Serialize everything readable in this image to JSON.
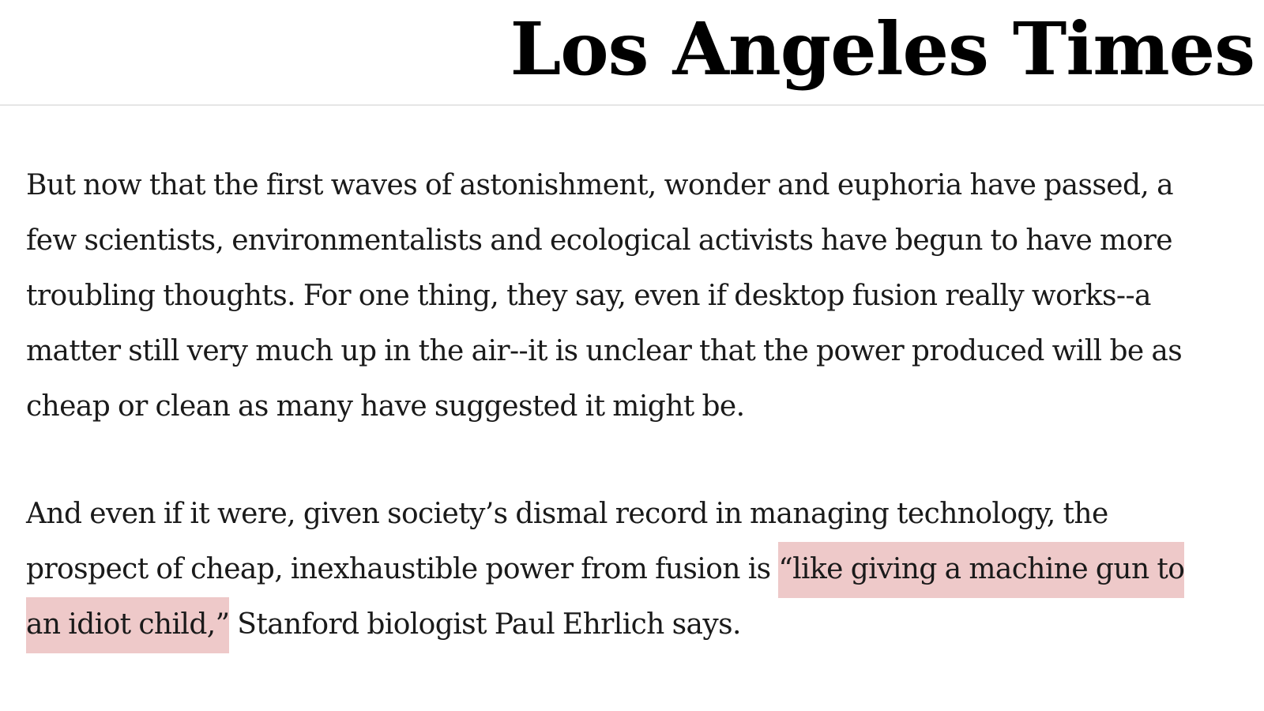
{
  "masthead": {
    "logo_text": "Los Angeles Times"
  },
  "article": {
    "paragraph_1": "But now that the first waves of astonishment, wonder and euphoria have passed, a few scientists, environmentalists and ecological activists have begun to have more troubling thoughts. For one thing, they say, even if desktop fusion really works--a matter still very much up in the air--it is unclear that the power produced will be as cheap or clean as many have suggested it might be.",
    "paragraph_2": {
      "before_highlight": "And even if it were, given society’s dismal record in managing technology, the prospect of cheap, inexhaustible power from fusion is ",
      "highlighted_quote": "“like giving a machine gun to an idiot child,”",
      "after_highlight": " Stanford biologist Paul Ehrlich says."
    }
  },
  "colors": {
    "highlight": "#eec9c9",
    "text": "#1a1a1a",
    "divider": "#e6e6e6"
  }
}
